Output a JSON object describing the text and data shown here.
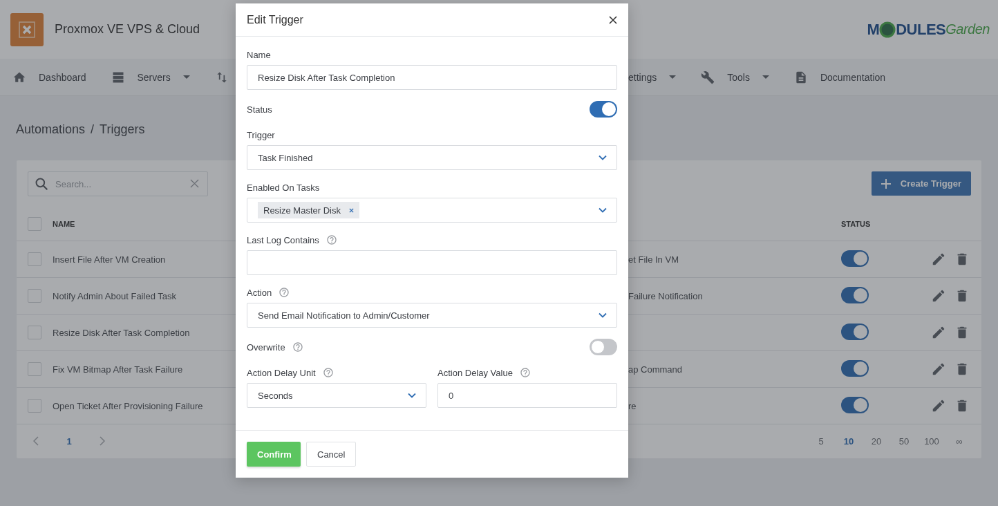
{
  "app": {
    "title": "Proxmox VE VPS & Cloud"
  },
  "logo": {
    "parts": [
      "M",
      "DULES",
      "Garden"
    ]
  },
  "nav_left": [
    {
      "kind": "home",
      "label": "Dashboard",
      "dropdown": false
    },
    {
      "kind": "servers",
      "label": "Servers",
      "dropdown": true
    },
    {
      "kind": "arrows",
      "dropdown": false
    }
  ],
  "nav_right": [
    {
      "kind": "text",
      "label": "ettings",
      "dropdown": true
    },
    {
      "kind": "wrench",
      "label": "Tools",
      "dropdown": true
    },
    {
      "kind": "document",
      "label": "Documentation",
      "dropdown": false
    }
  ],
  "breadcrumb": {
    "items": [
      "Automations",
      "Triggers"
    ],
    "separator": "/"
  },
  "search": {
    "placeholder": "Search..."
  },
  "create_button": "Create Trigger",
  "table": {
    "columns": [
      "NAME",
      "STATUS"
    ],
    "header_checked": false,
    "rows": [
      {
        "checked": false,
        "name": "Insert File After VM Creation",
        "column_2": "et File In VM",
        "status": true
      },
      {
        "checked": false,
        "name": "Notify Admin About Failed Task",
        "column_2": "Failure Notification",
        "status": true
      },
      {
        "checked": false,
        "name": "Resize Disk After Task Completion",
        "status": true
      },
      {
        "checked": false,
        "name": "Fix VM Bitmap After Task Failure",
        "column_2": "ap Command",
        "status": true
      },
      {
        "checked": false,
        "name": "Open Ticket After Provisioning Failure",
        "column_2": "re",
        "status": true
      }
    ]
  },
  "pagination": {
    "pages": [
      {
        "label": "1",
        "selected": true
      }
    ],
    "page_sizes": [
      {
        "label": "5",
        "selected": false
      },
      {
        "label": "10",
        "selected": true
      },
      {
        "label": "20",
        "selected": false
      },
      {
        "label": "50",
        "selected": false
      },
      {
        "label": "100",
        "selected": false
      },
      {
        "label": "∞",
        "selected": false
      }
    ]
  },
  "modal": {
    "title": "Edit Trigger",
    "fields": [
      {
        "kind": "text",
        "label": "Name",
        "value": "Resize Disk After Task Completion",
        "help": false
      },
      {
        "kind": "toggle",
        "label": "Status",
        "on": true,
        "help": false
      },
      {
        "kind": "select",
        "label": "Trigger",
        "value": "Task Finished",
        "help": false
      },
      {
        "kind": "tags",
        "label": "Enabled On Tasks",
        "tags": [
          "Resize Master Disk"
        ],
        "help": false
      },
      {
        "kind": "text",
        "label": "Last Log Contains",
        "help": true
      },
      {
        "kind": "select",
        "label": "Action",
        "value": "Send Email Notification to Admin/Customer",
        "help": true
      },
      {
        "kind": "toggle",
        "label": "Overwrite",
        "on": false,
        "help": true
      },
      {
        "kind": "pair",
        "children": [
          {
            "kind": "select",
            "label": "Action Delay Unit",
            "value": "Seconds",
            "help": true
          },
          {
            "kind": "text",
            "label": "Action Delay Value",
            "value": "0",
            "help": true
          }
        ]
      }
    ],
    "buttons": [
      {
        "kind": "primary",
        "label": "Confirm"
      },
      {
        "kind": "secondary",
        "label": "Cancel"
      }
    ]
  }
}
